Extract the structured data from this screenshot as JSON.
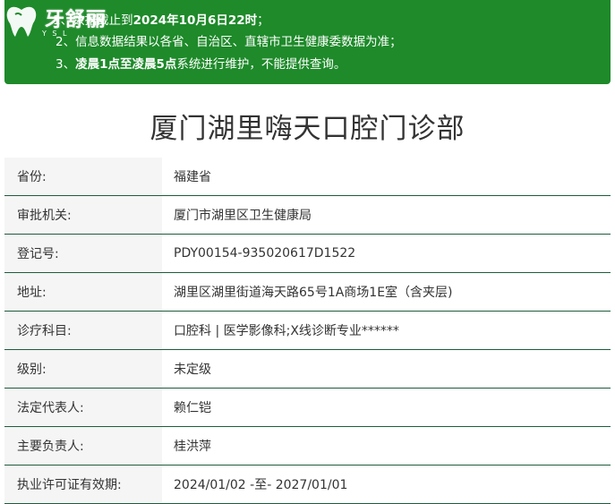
{
  "notice": {
    "line1_prefix": "1、数据截止到",
    "line1_bold": "2024年10月6日22时",
    "line1_suffix": "；",
    "line2": "2、信息数据结果以各省、自治区、直辖市卫生健康委数据为准；",
    "line3_prefix": "3、",
    "line3_bold": "凌晨1点至凌晨5点",
    "line3_suffix": "系统进行维护，不能提供查询。"
  },
  "logo": {
    "brand": "牙舒丽",
    "sub": "Y S L",
    "icon": "tooth-logo-icon"
  },
  "page_title": "厦门湖里嗨天口腔门诊部",
  "rows": [
    {
      "label": "省份:",
      "value": "福建省"
    },
    {
      "label": "审批机关:",
      "value": "厦门市湖里区卫生健康局"
    },
    {
      "label": "登记号:",
      "value": "PDY00154-935020617D1522"
    },
    {
      "label": "地址:",
      "value": "湖里区湖里街道海天路65号1A商场1E室（含夹层)"
    },
    {
      "label": "诊疗科目:",
      "value": "口腔科 | 医学影像科;X线诊断专业******"
    },
    {
      "label": "级别:",
      "value": "未定级"
    },
    {
      "label": "法定代表人:",
      "value": "赖仁铠"
    },
    {
      "label": "主要负责人:",
      "value": "桂洪萍"
    },
    {
      "label": "执业许可证有效期:",
      "value": "2024/01/02 -至- 2027/01/01"
    }
  ],
  "colors": {
    "notice_bg": "#1e8a2a",
    "row_border": "#1f5c3d",
    "label_bg": "#f5f5f5"
  }
}
